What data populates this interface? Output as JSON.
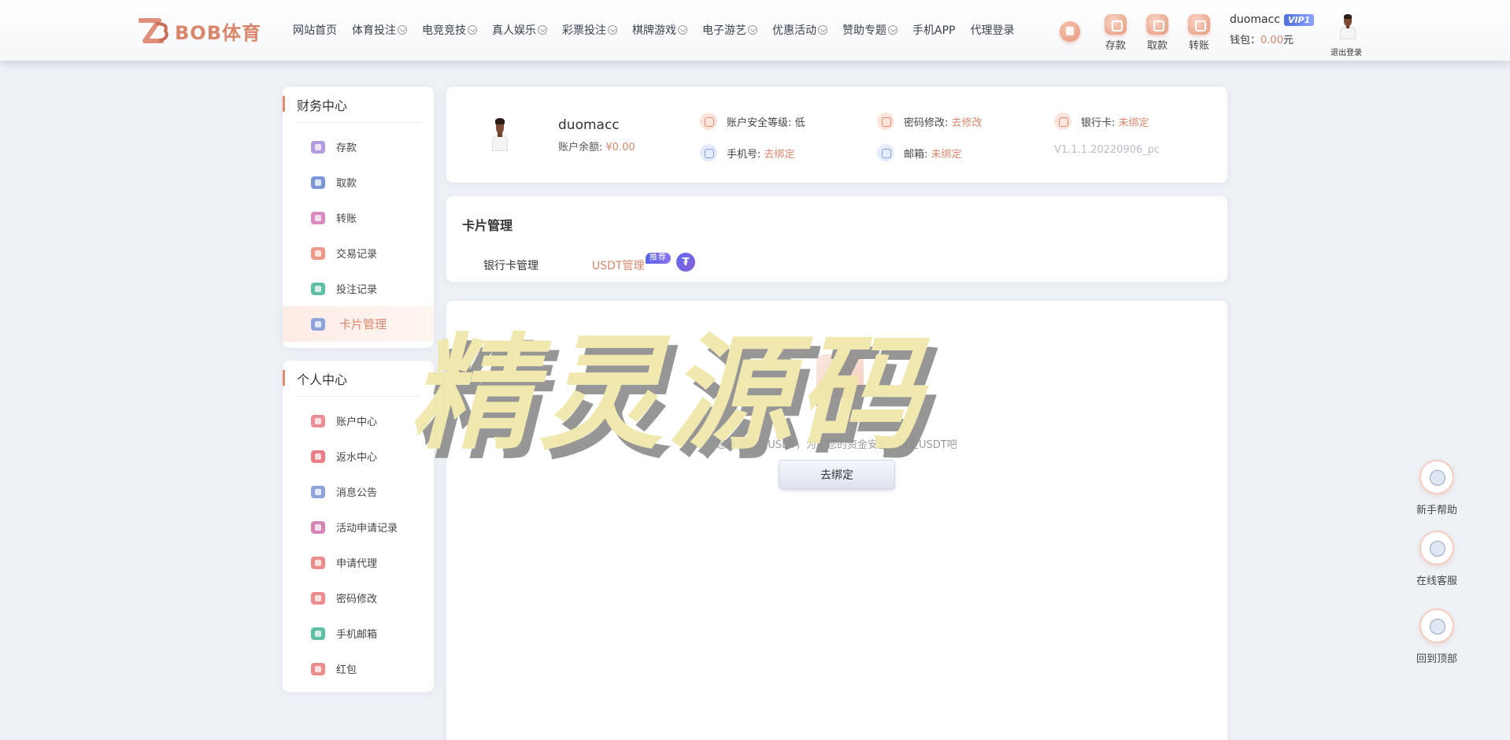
{
  "brand": {
    "logo_text": "BOB体育"
  },
  "nav": [
    {
      "label": "网站首页",
      "dropdown": false
    },
    {
      "label": "体育投注",
      "dropdown": true
    },
    {
      "label": "电竞竞技",
      "dropdown": true
    },
    {
      "label": "真人娱乐",
      "dropdown": true
    },
    {
      "label": "彩票投注",
      "dropdown": true
    },
    {
      "label": "棋牌游戏",
      "dropdown": true
    },
    {
      "label": "电子游艺",
      "dropdown": true
    },
    {
      "label": "优惠活动",
      "dropdown": true
    },
    {
      "label": "赞助专题",
      "dropdown": true
    },
    {
      "label": "手机APP",
      "dropdown": false
    },
    {
      "label": "代理登录",
      "dropdown": false
    }
  ],
  "quick_actions": [
    "存款",
    "取款",
    "转账"
  ],
  "user": {
    "name": "duomacc",
    "vip": "VIP1",
    "wallet_label": "钱包：",
    "wallet_amount": "0.00",
    "wallet_unit": "元",
    "logout": "退出登录"
  },
  "sidebar": {
    "finance_title": "财务中心",
    "finance_items": [
      {
        "label": "存款",
        "icon": "deposit-icon",
        "color": "#b39be0"
      },
      {
        "label": "取款",
        "icon": "withdraw-icon",
        "color": "#7d97d6"
      },
      {
        "label": "转账",
        "icon": "transfer-icon",
        "color": "#d98ac0"
      },
      {
        "label": "交易记录",
        "icon": "transaction-icon",
        "color": "#ec9a87"
      },
      {
        "label": "投注记录",
        "icon": "bet-record-icon",
        "color": "#5fbfa5"
      },
      {
        "label": "卡片管理",
        "icon": "card-icon",
        "color": "#8ea3d8",
        "active": true
      }
    ],
    "personal_title": "个人中心",
    "personal_items": [
      {
        "label": "账户中心",
        "icon": "heart-icon",
        "color": "#ec8c94"
      },
      {
        "label": "返水中心",
        "icon": "gift-icon",
        "color": "#e87d86"
      },
      {
        "label": "消息公告",
        "icon": "bell-icon",
        "color": "#8fa2d9"
      },
      {
        "label": "活动申请记录",
        "icon": "profile-icon",
        "color": "#d685b5"
      },
      {
        "label": "申请代理",
        "icon": "agent-icon",
        "color": "#ec8d8d"
      },
      {
        "label": "密码修改",
        "icon": "lock-icon",
        "color": "#ec8d8d"
      },
      {
        "label": "手机邮箱",
        "icon": "mail-icon",
        "color": "#5fbfa5"
      },
      {
        "label": "红包",
        "icon": "red-packet-icon",
        "color": "#ec8d8d"
      }
    ]
  },
  "profile": {
    "name": "duomacc",
    "balance_label": "账户余额:",
    "balance": "¥0.00",
    "security_label": "账户安全等级:",
    "security_level": "低",
    "password_label": "密码修改:",
    "password_action": "去修改",
    "bank_label": "银行卡:",
    "bank_status": "未绑定",
    "phone_label": "手机号:",
    "phone_action": "去绑定",
    "email_label": "邮箱:",
    "email_status": "未绑定",
    "version": "V1.1.1.20220906_pc"
  },
  "card_mgmt": {
    "title": "卡片管理",
    "tab_bank": "银行卡管理",
    "tab_usdt": "USDT管理",
    "badge": "推荐",
    "usdt_symbol": "₮"
  },
  "content": {
    "empty_text": "您还没绑定USDT，为了您的资金安全，绑定USDT吧",
    "bind_button": "去绑定"
  },
  "watermark": "精灵源码",
  "float_buttons": [
    "新手帮助",
    "在线客服",
    "回到顶部"
  ],
  "colors": {
    "accent": "#d9876c",
    "background": "#eef1f6",
    "vip": "#4f6fe0"
  }
}
